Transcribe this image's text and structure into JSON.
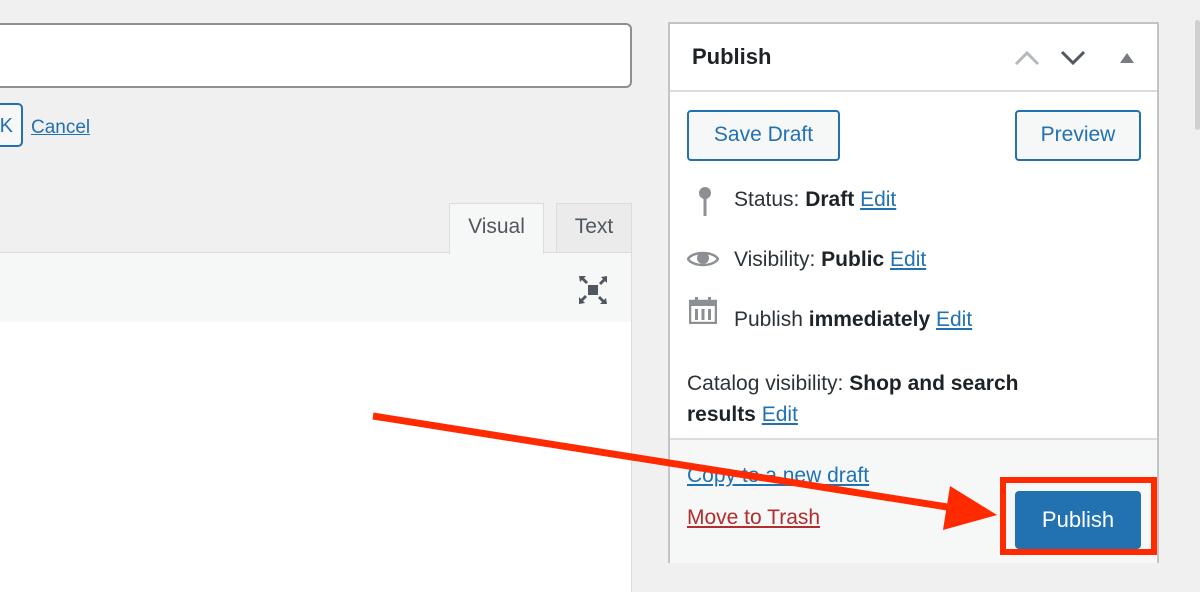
{
  "editor": {
    "ok_label": "K",
    "cancel_label": "Cancel",
    "tabs": [
      {
        "label": "Visual",
        "active": true
      },
      {
        "label": "Text",
        "active": false
      }
    ]
  },
  "publish_box": {
    "title": "Publish",
    "save_draft": "Save Draft",
    "preview": "Preview",
    "status": {
      "label": "Status:",
      "value": "Draft",
      "edit": "Edit"
    },
    "visibility": {
      "label": "Visibility:",
      "value": "Public",
      "edit": "Edit"
    },
    "schedule": {
      "label": "Publish",
      "value": "immediately",
      "edit": "Edit"
    },
    "catalog": {
      "label": "Catalog visibility:",
      "value_line1": "Shop and search",
      "value_line2": "results",
      "edit": "Edit"
    },
    "copy_draft": "Copy to a new draft",
    "trash": "Move to Trash",
    "publish": "Publish"
  },
  "colors": {
    "accent": "#2271b1",
    "trash": "#b32d2e",
    "annotation": "#ff2a00"
  }
}
